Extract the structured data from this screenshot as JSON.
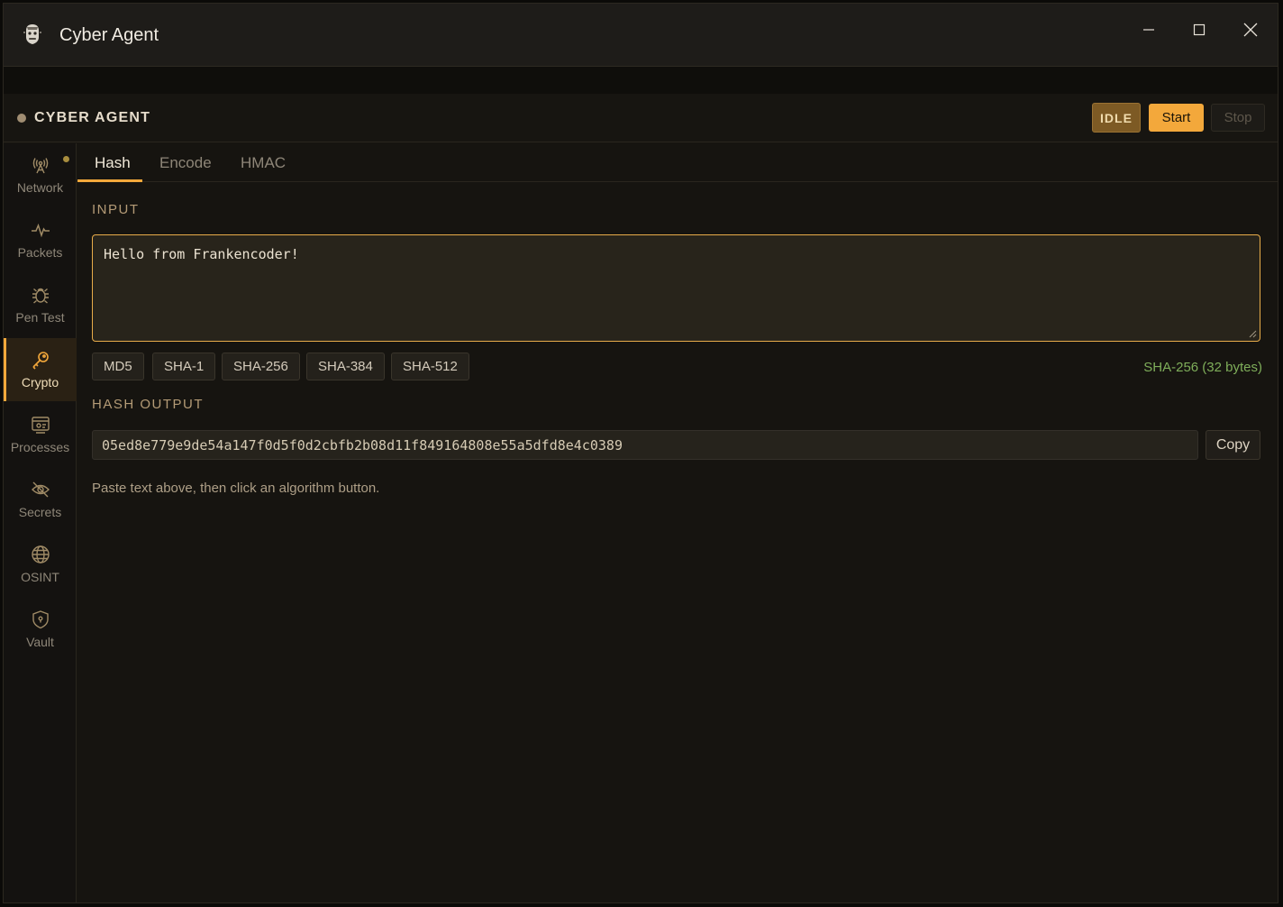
{
  "window": {
    "title": "Cyber Agent",
    "controls": [
      "minimize-icon",
      "maximize-icon",
      "close-icon"
    ]
  },
  "header": {
    "brand": "CYBER AGENT",
    "status": "IDLE",
    "start_label": "Start",
    "stop_label": "Stop"
  },
  "sidebar": {
    "items": [
      {
        "label": "Network",
        "icon": "antenna-icon",
        "active": false
      },
      {
        "label": "Packets",
        "icon": "pulse-icon",
        "active": false
      },
      {
        "label": "Pen Test",
        "icon": "bug-icon",
        "active": false
      },
      {
        "label": "Crypto",
        "icon": "key-icon",
        "active": true
      },
      {
        "label": "Processes",
        "icon": "processes-icon",
        "active": false
      },
      {
        "label": "Secrets",
        "icon": "eye-off-icon",
        "active": false
      },
      {
        "label": "OSINT",
        "icon": "globe-icon",
        "active": false
      },
      {
        "label": "Vault",
        "icon": "shield-lock-icon",
        "active": false
      }
    ]
  },
  "tabs": [
    {
      "label": "Hash",
      "active": true
    },
    {
      "label": "Encode",
      "active": false
    },
    {
      "label": "HMAC",
      "active": false
    }
  ],
  "input": {
    "label": "INPUT",
    "value": "Hello from Frankencoder!"
  },
  "algorithms": [
    "MD5",
    "SHA-1",
    "SHA-256",
    "SHA-384",
    "SHA-512"
  ],
  "algo_status": "SHA-256 (32 bytes)",
  "output": {
    "label": "HASH OUTPUT",
    "value": "05ed8e779e9de54a147f0d5f0d2cbfb2b08d11f849164808e55a5dfd8e4c0389",
    "copy_label": "Copy",
    "hint": "Paste text above, then click an algorithm button."
  },
  "colors": {
    "accent": "#f3a83b",
    "success": "#7fae5a",
    "idle_badge": "#7d5a24"
  }
}
